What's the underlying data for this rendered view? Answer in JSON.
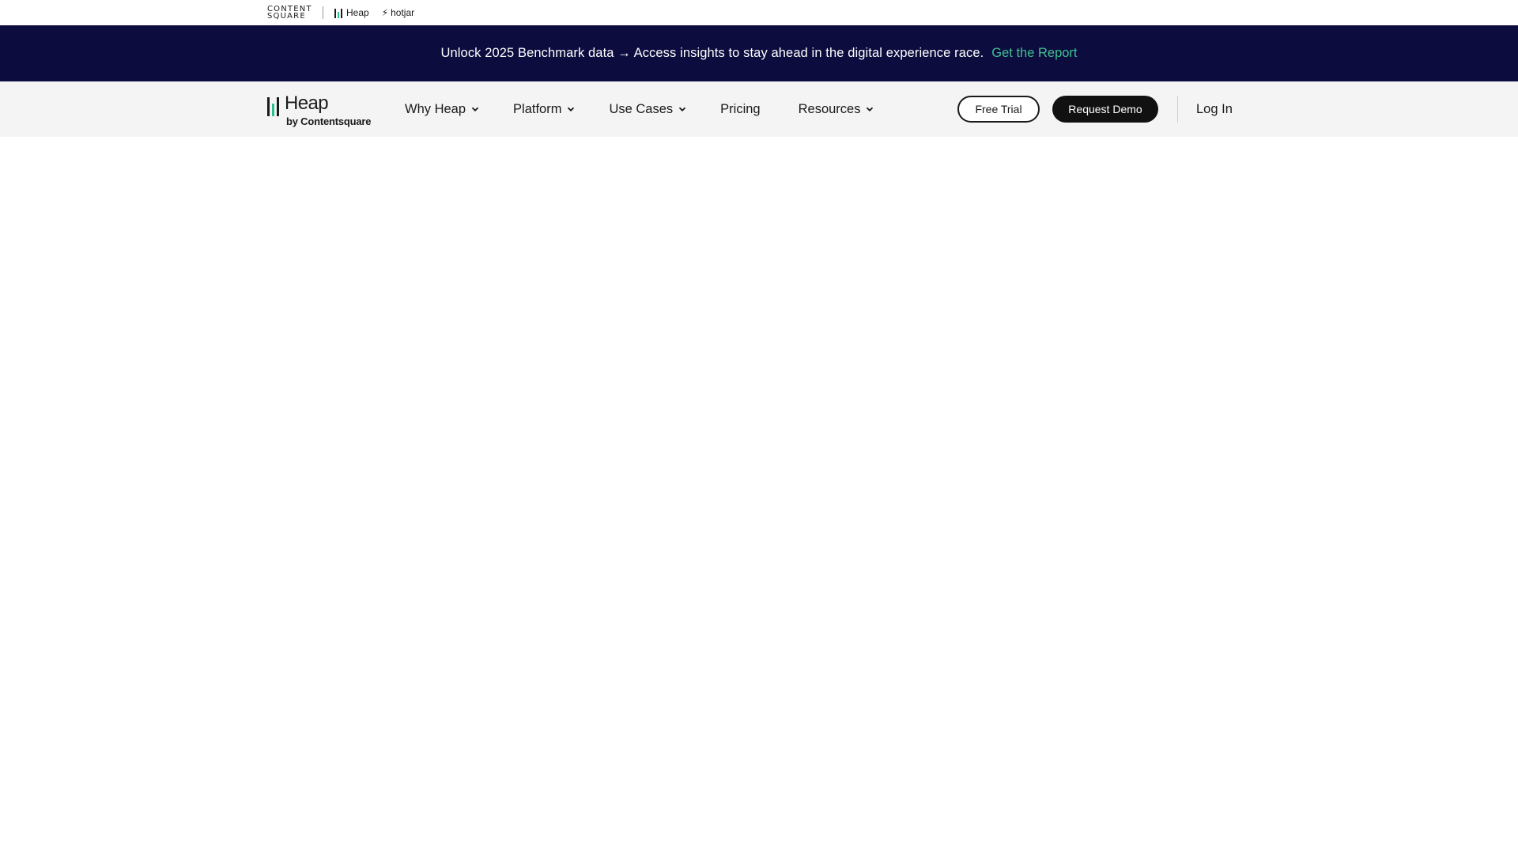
{
  "brand_strip": {
    "contentsquare_line1": "CONTENT",
    "contentsquare_line2": "SQUARE",
    "heap_label": "Heap",
    "hotjar_label": "hotjar"
  },
  "announcement": {
    "text": "Unlock 2025 Benchmark data → Access insights to stay ahead in the digital experience race.",
    "link_label": "Get the Report"
  },
  "nav": {
    "logo_word": "Heap",
    "logo_sub": "by Contentsquare",
    "items": [
      {
        "label": "Why Heap",
        "has_dropdown": true
      },
      {
        "label": "Platform",
        "has_dropdown": true
      },
      {
        "label": "Use Cases",
        "has_dropdown": true
      },
      {
        "label": "Pricing",
        "has_dropdown": false
      },
      {
        "label": "Resources",
        "has_dropdown": true
      }
    ],
    "free_trial_label": "Free Trial",
    "request_demo_label": "Request Demo",
    "login_label": "Log In"
  },
  "colors": {
    "announcement_bg": "#0c0c3f",
    "accent_green": "#3fc190",
    "nav_bg": "#f4f4f4",
    "primary_button": "#111111"
  }
}
